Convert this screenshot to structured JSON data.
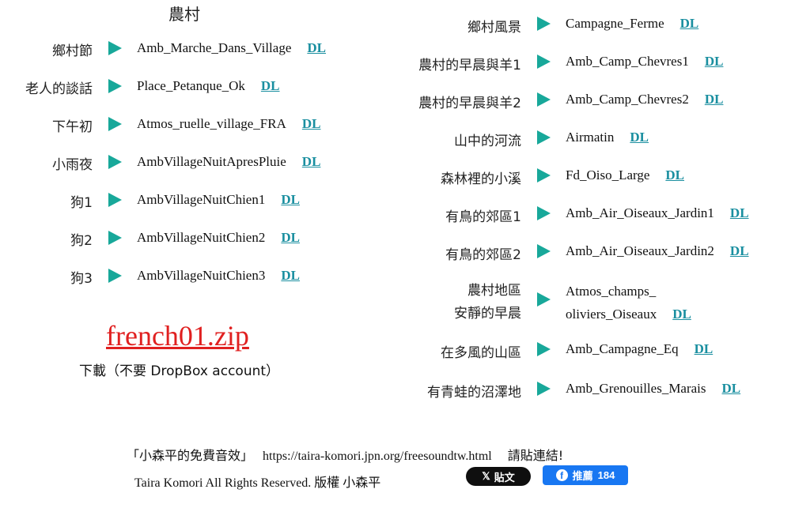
{
  "left": {
    "title": "農村",
    "items": [
      {
        "label": "鄉村節",
        "file": "Amb_Marche_Dans_Village",
        "dl": "DL"
      },
      {
        "label": "老人的談話",
        "file": "Place_Petanque_Ok",
        "dl": "DL"
      },
      {
        "label": "下午初",
        "file": "Atmos_ruelle_village_FRA",
        "dl": "DL"
      },
      {
        "label": "小雨夜",
        "file": "AmbVillageNuitApresPluie",
        "dl": "DL"
      },
      {
        "label": "狗1",
        "file": "AmbVillageNuitChien1",
        "dl": "DL"
      },
      {
        "label": "狗2",
        "file": "AmbVillageNuitChien2",
        "dl": "DL"
      },
      {
        "label": "狗3",
        "file": "AmbVillageNuitChien3",
        "dl": "DL"
      }
    ],
    "zip": {
      "link": "french01.zip",
      "note": "下載（不要 DropBox account）"
    }
  },
  "right": {
    "items": [
      {
        "label": "鄉村風景",
        "file": "Campagne_Ferme",
        "dl": "DL"
      },
      {
        "label": "農村的早晨與羊1",
        "file": "Amb_Camp_Chevres1",
        "dl": "DL"
      },
      {
        "label": "農村的早晨與羊2",
        "file": "Amb_Camp_Chevres2",
        "dl": "DL"
      },
      {
        "label": "山中的河流",
        "file": "Airmatin",
        "dl": "DL"
      },
      {
        "label": "森林裡的小溪",
        "file": "Fd_Oiso_Large",
        "dl": "DL"
      },
      {
        "label": "有鳥的郊區1",
        "file": "Amb_Air_Oiseaux_Jardin1",
        "dl": "DL"
      },
      {
        "label": "有鳥的郊區2",
        "file": "Amb_Air_Oiseaux_Jardin2",
        "dl": "DL"
      },
      {
        "label": "農村地區",
        "label2": "安靜的早晨",
        "file": "Atmos_champs_",
        "file2": "oliviers_Oiseaux",
        "dl": "DL"
      },
      {
        "label": "在多風的山區",
        "file": "Amb_Campagne_Eq",
        "dl": "DL"
      },
      {
        "label": "有青蛙的沼澤地",
        "file": "Amb_Grenouilles_Marais",
        "dl": "DL"
      }
    ]
  },
  "footer": {
    "credit_name": "「小森平的免費音效」",
    "url": "https://taira-komori.jpn.org/freesoundtw.html",
    "request": "請貼連結!",
    "copyright": "Taira Komori All Rights Reserved. 版權 小森平",
    "x_button": "貼文",
    "x_icon_glyph": "𝕏",
    "fb_icon_glyph": "f",
    "fb_button": "推薦",
    "fb_count": "184"
  },
  "colors": {
    "arrow": "#18a89a",
    "dl_link": "#1a8fa0",
    "zip_link": "#e02020",
    "fb": "#1877f2"
  }
}
